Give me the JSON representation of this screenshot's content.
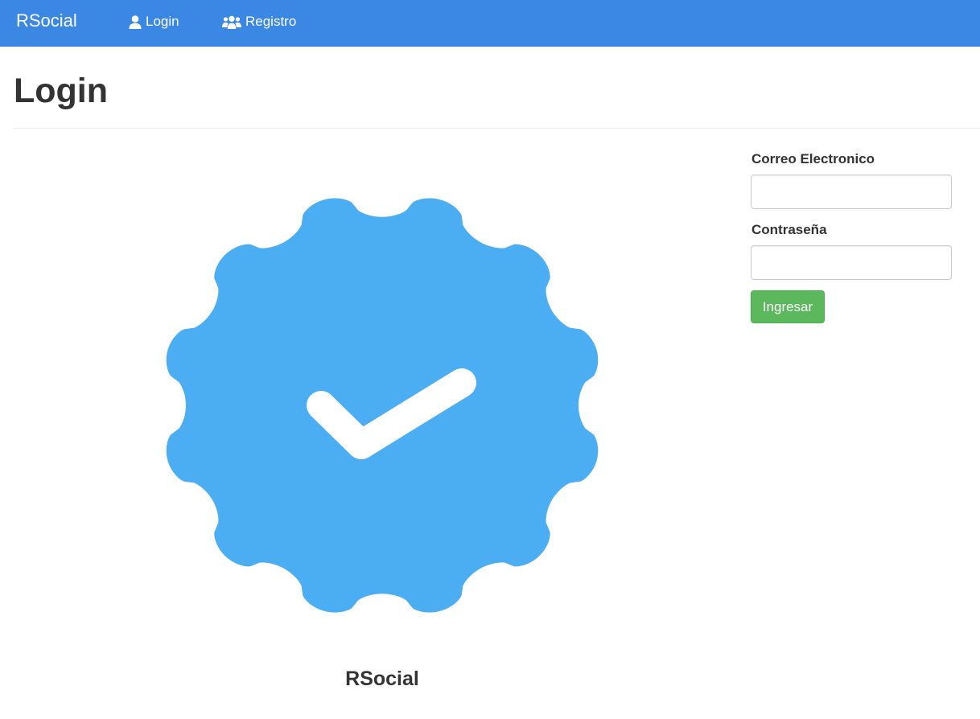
{
  "navbar": {
    "brand": "RSocial",
    "links": [
      {
        "label": "Login",
        "icon": "user-icon"
      },
      {
        "label": "Registro",
        "icon": "users-icon"
      }
    ],
    "background_color": "#3b88e4"
  },
  "page": {
    "title": "Login"
  },
  "hero": {
    "icon": "verified-badge-icon",
    "badge_color": "#4badf2",
    "caption": "RSocial"
  },
  "form": {
    "email_label": "Correo Electronico",
    "email_value": "",
    "password_label": "Contraseña",
    "password_value": "",
    "submit_label": "Ingresar",
    "submit_color": "#5cb85c"
  }
}
